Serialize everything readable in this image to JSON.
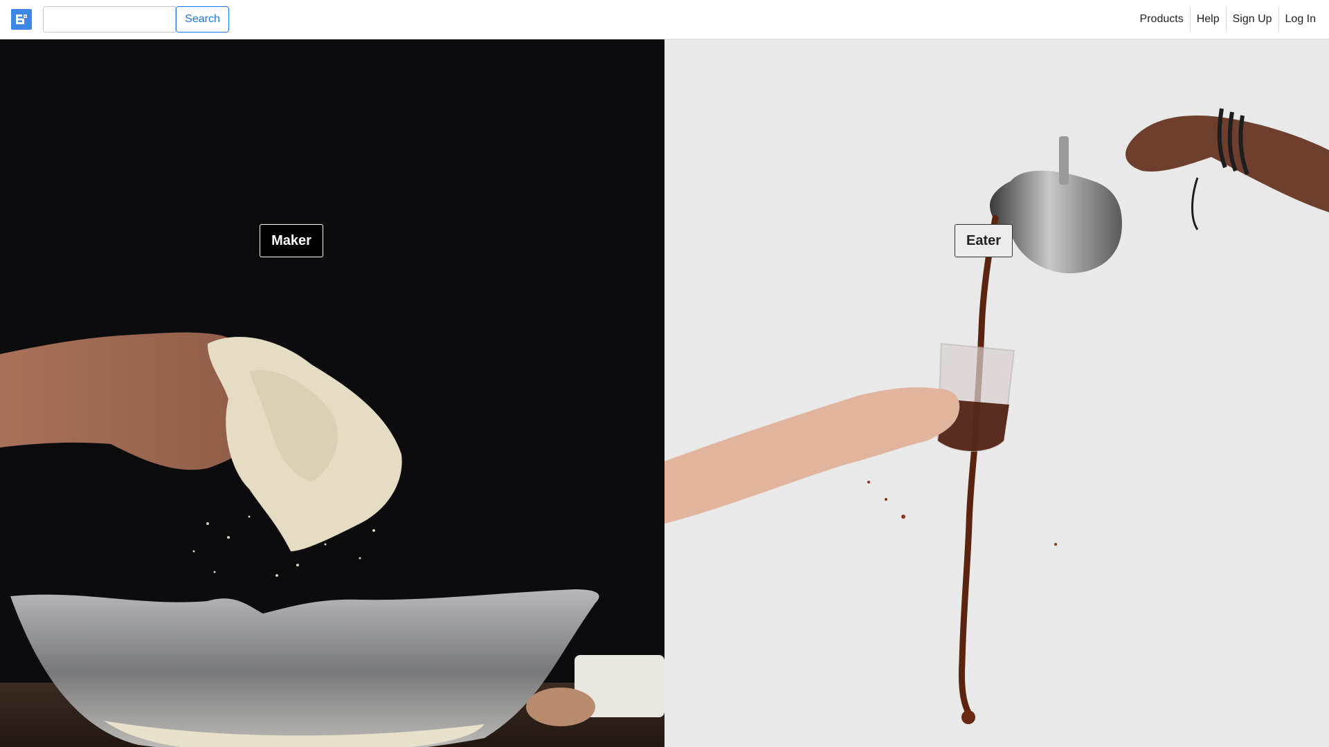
{
  "header": {
    "logo_icon": "stylized-B-logo-icon",
    "search": {
      "value": "",
      "placeholder": "",
      "button_label": "Search"
    },
    "nav": [
      {
        "label": "Products"
      },
      {
        "label": "Help"
      },
      {
        "label": "Sign Up"
      },
      {
        "label": "Log In"
      }
    ]
  },
  "hero": {
    "maker": {
      "label": "Maker",
      "image": "hands-kneading-dough-over-glass-bowl"
    },
    "eater": {
      "label": "Eater",
      "image": "pouring-coffee-from-pitcher-into-glass"
    }
  },
  "colors": {
    "accent": "#1a73e8",
    "logo": "#3d87e6",
    "maker_bg": "#0c0b0d",
    "eater_bg": "#e9e9ea"
  }
}
